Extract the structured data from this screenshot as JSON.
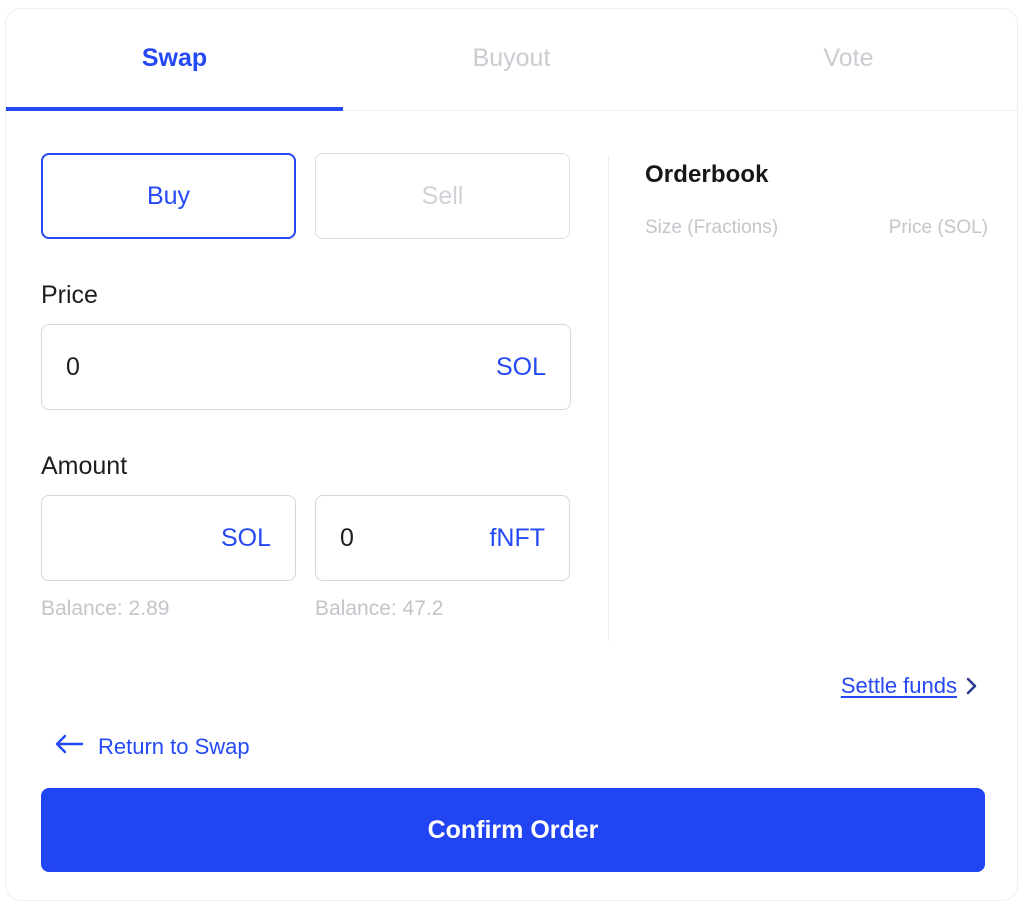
{
  "tabs": [
    {
      "label": "Swap",
      "active": true
    },
    {
      "label": "Buyout",
      "active": false
    },
    {
      "label": "Vote",
      "active": false
    }
  ],
  "side_toggle": {
    "buy_label": "Buy",
    "sell_label": "Sell",
    "selected": "Buy"
  },
  "price": {
    "label": "Price",
    "value": "0",
    "placeholder": "0",
    "unit": "SOL"
  },
  "amount": {
    "label": "Amount",
    "sol_field": {
      "value": "",
      "placeholder": "",
      "unit": "SOL",
      "balance": "Balance: 2.89"
    },
    "fnft_field": {
      "value": "0",
      "placeholder": "0",
      "unit": "fNFT",
      "balance": "Balance: 47.2"
    }
  },
  "orderbook": {
    "title": "Orderbook",
    "columns": [
      "Size (Fractions)",
      "Price (SOL)"
    ],
    "rows": []
  },
  "settle": {
    "label": "Settle funds",
    "chevron": "chevron-right-icon"
  },
  "return_link": {
    "label": "Return to Swap",
    "arrow": "arrow-left-icon"
  },
  "confirm": {
    "label": "Confirm Order"
  },
  "colors": {
    "accent": "#2449f5",
    "button": "#2245f3",
    "muted": "#c3c6ca",
    "border": "#d5d7da",
    "text": "#1c1e21"
  }
}
